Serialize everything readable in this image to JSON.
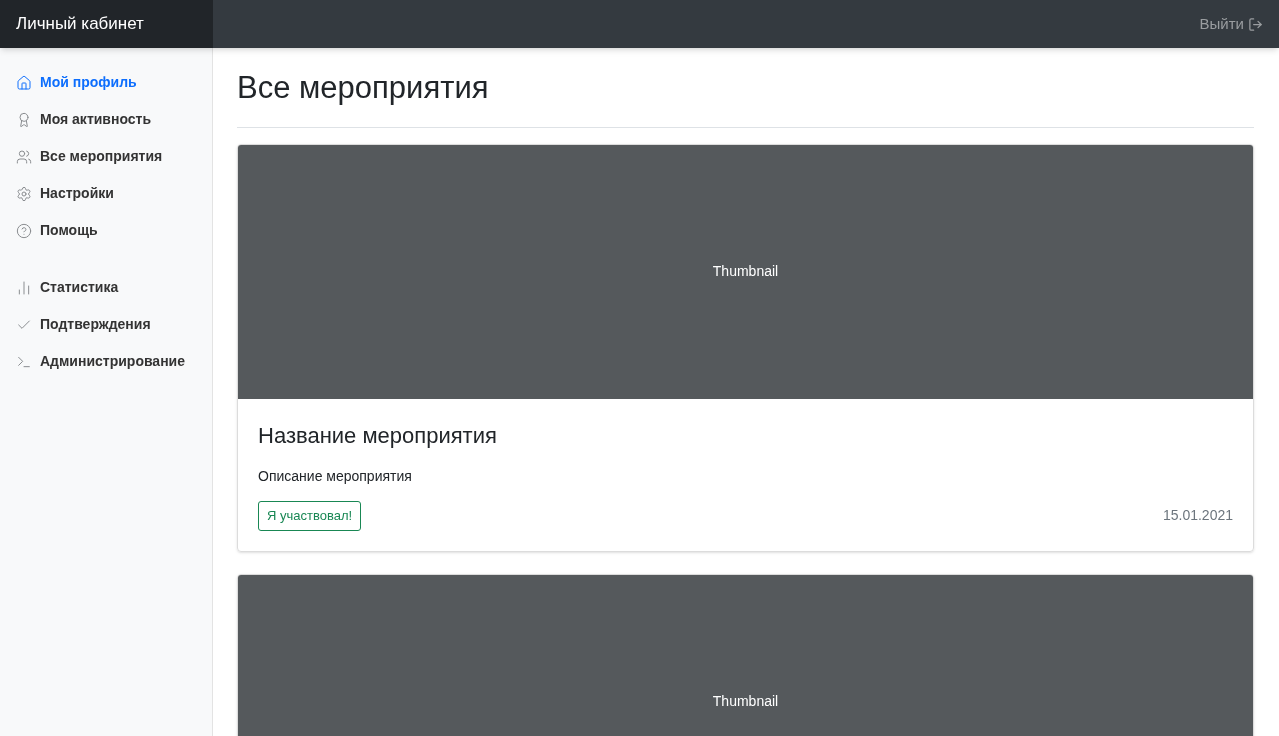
{
  "header": {
    "brand": "Личный кабинет",
    "logout": "Выйти"
  },
  "sidebar": {
    "groups": [
      {
        "items": [
          {
            "label": "Мой профиль",
            "kind": "home",
            "selected": true
          },
          {
            "label": "Моя активность",
            "kind": "award",
            "selected": false
          },
          {
            "label": "Все мероприятия",
            "kind": "users",
            "selected": false
          },
          {
            "label": "Настройки",
            "kind": "settings",
            "selected": false
          },
          {
            "label": "Помощь",
            "kind": "help",
            "selected": false
          }
        ]
      },
      {
        "items": [
          {
            "label": "Статистика",
            "kind": "stats",
            "selected": false
          },
          {
            "label": "Подтверждения",
            "kind": "check",
            "selected": false
          },
          {
            "label": "Администрирование",
            "kind": "terminal",
            "selected": false
          }
        ]
      }
    ]
  },
  "page": {
    "title": "Все мероприятия"
  },
  "events": [
    {
      "thumbnail": "Thumbnail",
      "title": "Название мероприятия",
      "description": "Описание мероприятия",
      "badge": "Я участвовал!",
      "date": "15.01.2021"
    },
    {
      "thumbnail": "Thumbnail"
    }
  ]
}
